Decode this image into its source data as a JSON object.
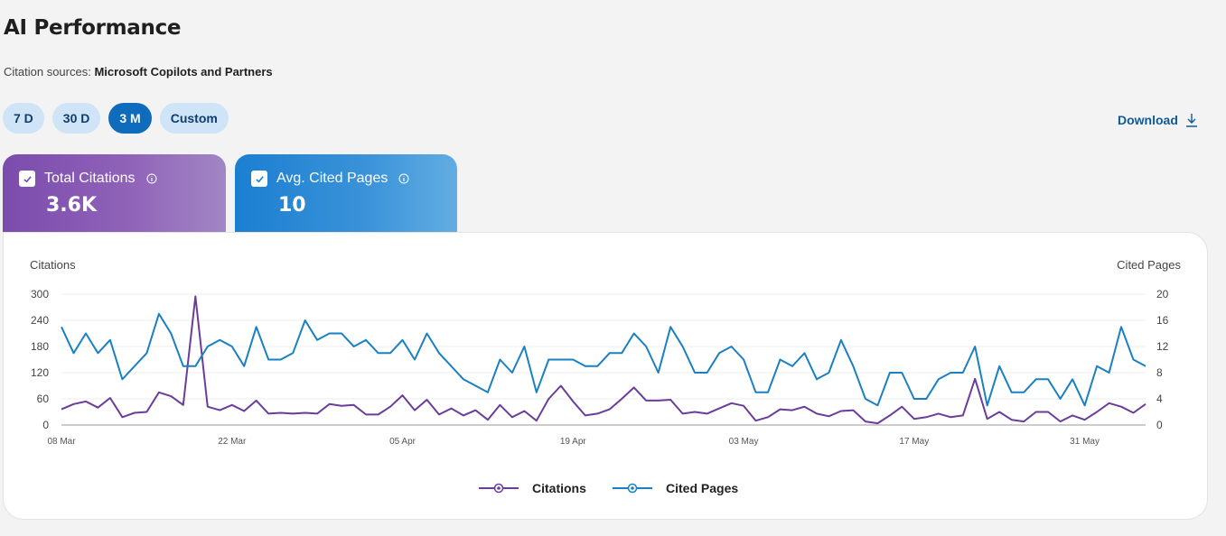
{
  "page": {
    "title": "AI Performance",
    "citation_sources_label": "Citation sources:",
    "citation_sources_value": "Microsoft Copilots and Partners"
  },
  "range": {
    "options": [
      "7 D",
      "30 D",
      "3 M",
      "Custom"
    ],
    "selected": "3 M"
  },
  "download": {
    "label": "Download",
    "icon": "download-icon"
  },
  "cards": {
    "citations": {
      "label": "Total Citations",
      "value": "3.6K",
      "checked": true,
      "color": "#7b4cad"
    },
    "cited_pages": {
      "label": "Avg. Cited Pages",
      "value": "10",
      "checked": true,
      "color": "#1b7fd1"
    }
  },
  "chart_data": {
    "type": "line",
    "left_axis_title": "Citations",
    "right_axis_title": "Cited Pages",
    "left_ticks": [
      "0",
      "60",
      "120",
      "180",
      "240",
      "300"
    ],
    "right_ticks": [
      "0",
      "4",
      "8",
      "12",
      "16",
      "20"
    ],
    "ylim_left": [
      0,
      300
    ],
    "ylim_right": [
      0,
      20
    ],
    "x_tick_labels": [
      "08 Mar",
      "22 Mar",
      "05 Apr",
      "19 Apr",
      "03 May",
      "17 May",
      "31 May"
    ],
    "series": [
      {
        "name": "Citations",
        "color": "#6a3d9a",
        "axis": "left",
        "values": [
          36,
          48,
          54,
          40,
          62,
          18,
          28,
          30,
          75,
          66,
          46,
          295,
          42,
          34,
          46,
          32,
          56,
          26,
          28,
          26,
          28,
          26,
          48,
          44,
          46,
          24,
          24,
          42,
          68,
          34,
          58,
          24,
          38,
          22,
          34,
          12,
          46,
          18,
          32,
          10,
          60,
          90,
          54,
          22,
          26,
          36,
          60,
          86,
          56,
          56,
          58,
          26,
          30,
          26,
          38,
          50,
          44,
          10,
          18,
          36,
          34,
          42,
          26,
          20,
          32,
          34,
          8,
          4,
          22,
          42,
          14,
          18,
          26,
          18,
          22,
          106,
          14,
          30,
          12,
          8,
          30,
          30,
          8,
          22,
          12,
          30,
          50,
          42,
          28,
          48
        ]
      },
      {
        "name": "Cited Pages",
        "color": "#1a80c4",
        "axis": "right",
        "values": [
          15,
          11,
          14,
          11,
          13,
          7,
          9,
          11,
          17,
          14,
          9,
          9,
          12,
          13,
          12,
          9,
          15,
          10,
          10,
          11,
          16,
          13,
          14,
          14,
          12,
          13,
          11,
          11,
          13,
          10,
          14,
          11,
          9,
          7,
          6,
          5,
          10,
          8,
          12,
          5,
          10,
          10,
          10,
          9,
          9,
          11,
          11,
          14,
          12,
          8,
          15,
          12,
          8,
          8,
          11,
          12,
          10,
          5,
          5,
          10,
          9,
          11,
          7,
          8,
          13,
          9,
          4,
          3,
          8,
          8,
          4,
          4,
          7,
          8,
          8,
          12,
          3,
          9,
          5,
          5,
          7,
          7,
          4,
          7,
          3,
          9,
          8,
          15,
          10,
          9
        ]
      }
    ],
    "legend": [
      "Citations",
      "Cited Pages"
    ],
    "legend_position": "bottom-center",
    "grid": true
  }
}
